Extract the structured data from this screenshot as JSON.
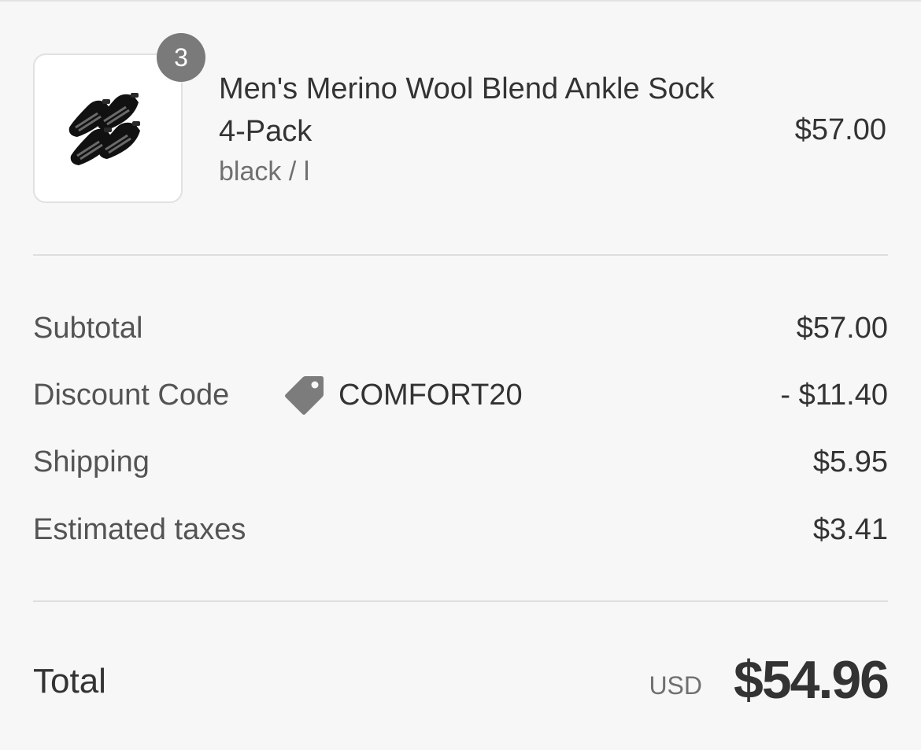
{
  "line_item": {
    "quantity": "3",
    "name": "Men's Merino Wool Blend Ankle Sock 4-Pack",
    "variant": "black / l",
    "price": "$57.00",
    "image_icon": "ankle-socks-image"
  },
  "summary": {
    "subtotal_label": "Subtotal",
    "subtotal_value": "$57.00",
    "discount_label": "Discount Code",
    "discount_code": "COMFORT20",
    "discount_icon": "tag-icon",
    "discount_value": "- $11.40",
    "shipping_label": "Shipping",
    "shipping_value": "$5.95",
    "taxes_label": "Estimated taxes",
    "taxes_value": "$3.41"
  },
  "total": {
    "label": "Total",
    "currency": "USD",
    "amount": "$54.96"
  },
  "colors": {
    "background": "#f7f7f7",
    "badge": "#7a7a7a",
    "text_primary": "#333333",
    "text_secondary": "#707070",
    "divider": "#dedede",
    "tag_icon": "#7c7c7c"
  }
}
